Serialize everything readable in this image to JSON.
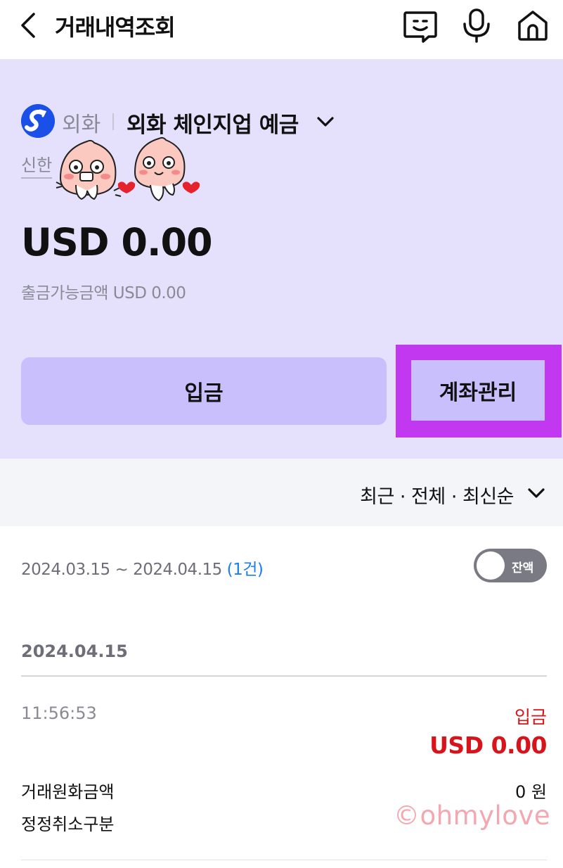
{
  "header": {
    "title": "거래내역조회"
  },
  "account": {
    "bank_type": "외화",
    "product_name": "외화 체인지업 예금",
    "bank_name": "신한",
    "balance": "USD 0.00",
    "withdrawable": "출금가능금액 USD 0.00",
    "deposit_label": "입금",
    "manage_label": "계좌관리"
  },
  "filter": {
    "text": "최근 · 전체 · 최신순"
  },
  "period": {
    "range": "2024.03.15 ~ 2024.04.15",
    "count": "(1건)",
    "toggle_label": "잔액"
  },
  "transactions": [
    {
      "date": "2024.04.15",
      "time": "11:56:53",
      "type": "입금",
      "amount": "USD 0.00",
      "krw_label": "거래원화금액",
      "krw_value": "0 원",
      "cancel_label": "정정취소구분"
    }
  ],
  "watermark": "©ohmylove",
  "colors": {
    "card_bg": "#e5e1fc",
    "button_bg": "#c8bffc",
    "highlight": "#c237f0",
    "deposit_red": "#d8141b",
    "link_blue": "#1b7df0"
  }
}
